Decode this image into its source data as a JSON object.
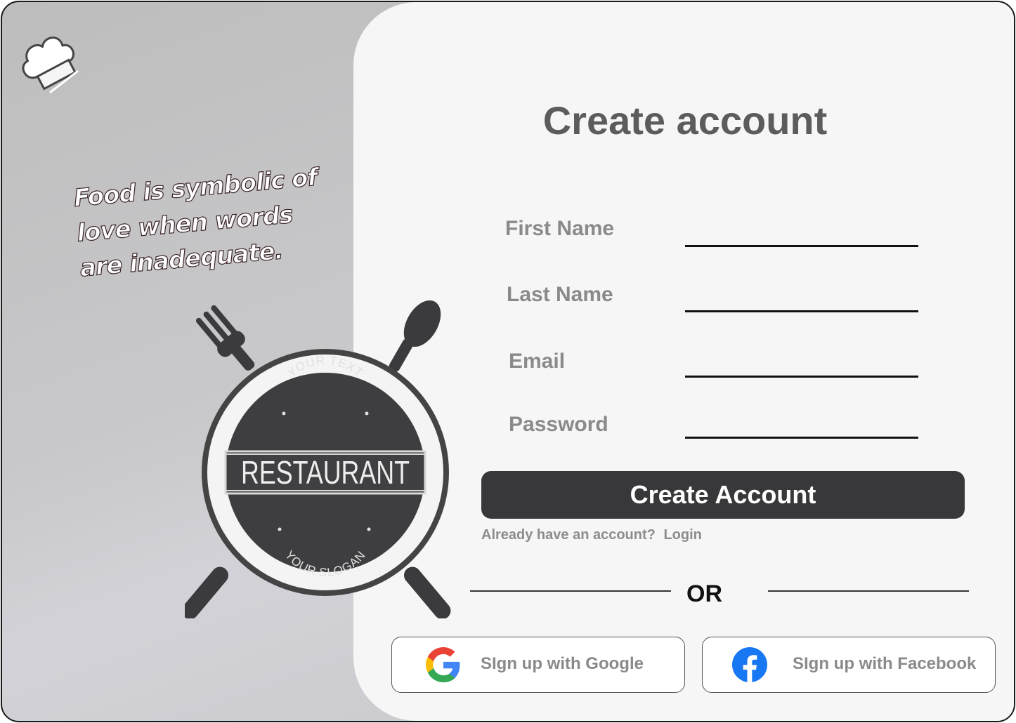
{
  "quote": {
    "line1": "Food is symbolic of",
    "line2": "love when words",
    "line3": "are inadequate."
  },
  "logo": {
    "top_text": "YOUR TEXT",
    "name": "RESTAURANT",
    "slogan": "YOUR SLOGAN"
  },
  "form": {
    "title": "Create account",
    "fields": [
      {
        "label": "First Name",
        "value": ""
      },
      {
        "label": "Last Name",
        "value": ""
      },
      {
        "label": "Email",
        "value": ""
      },
      {
        "label": "Password",
        "value": ""
      }
    ],
    "submit_label": "Create Account",
    "already_text": "Already have an account?",
    "login_label": "Login",
    "or_label": "OR"
  },
  "social": {
    "google_label": "SIgn up with Google",
    "facebook_label": "SIgn up with Facebook"
  },
  "colors": {
    "accent": "#38383a",
    "facebook": "#1877F2",
    "google_blue": "#4285F4",
    "google_red": "#EA4335",
    "google_yellow": "#FBBC05",
    "google_green": "#34A853"
  }
}
